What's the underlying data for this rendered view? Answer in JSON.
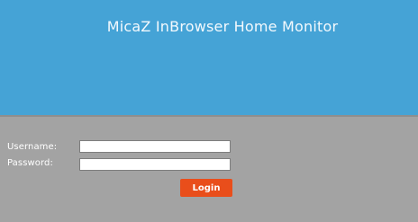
{
  "header": {
    "title": "MicaZ InBrowser Home Monitor",
    "background_color": "#45a3d6"
  },
  "login_form": {
    "username_label": "Username:",
    "username_value": "",
    "password_label": "Password:",
    "password_value": "",
    "login_label": "Login",
    "login_color": "#e94e1b"
  }
}
